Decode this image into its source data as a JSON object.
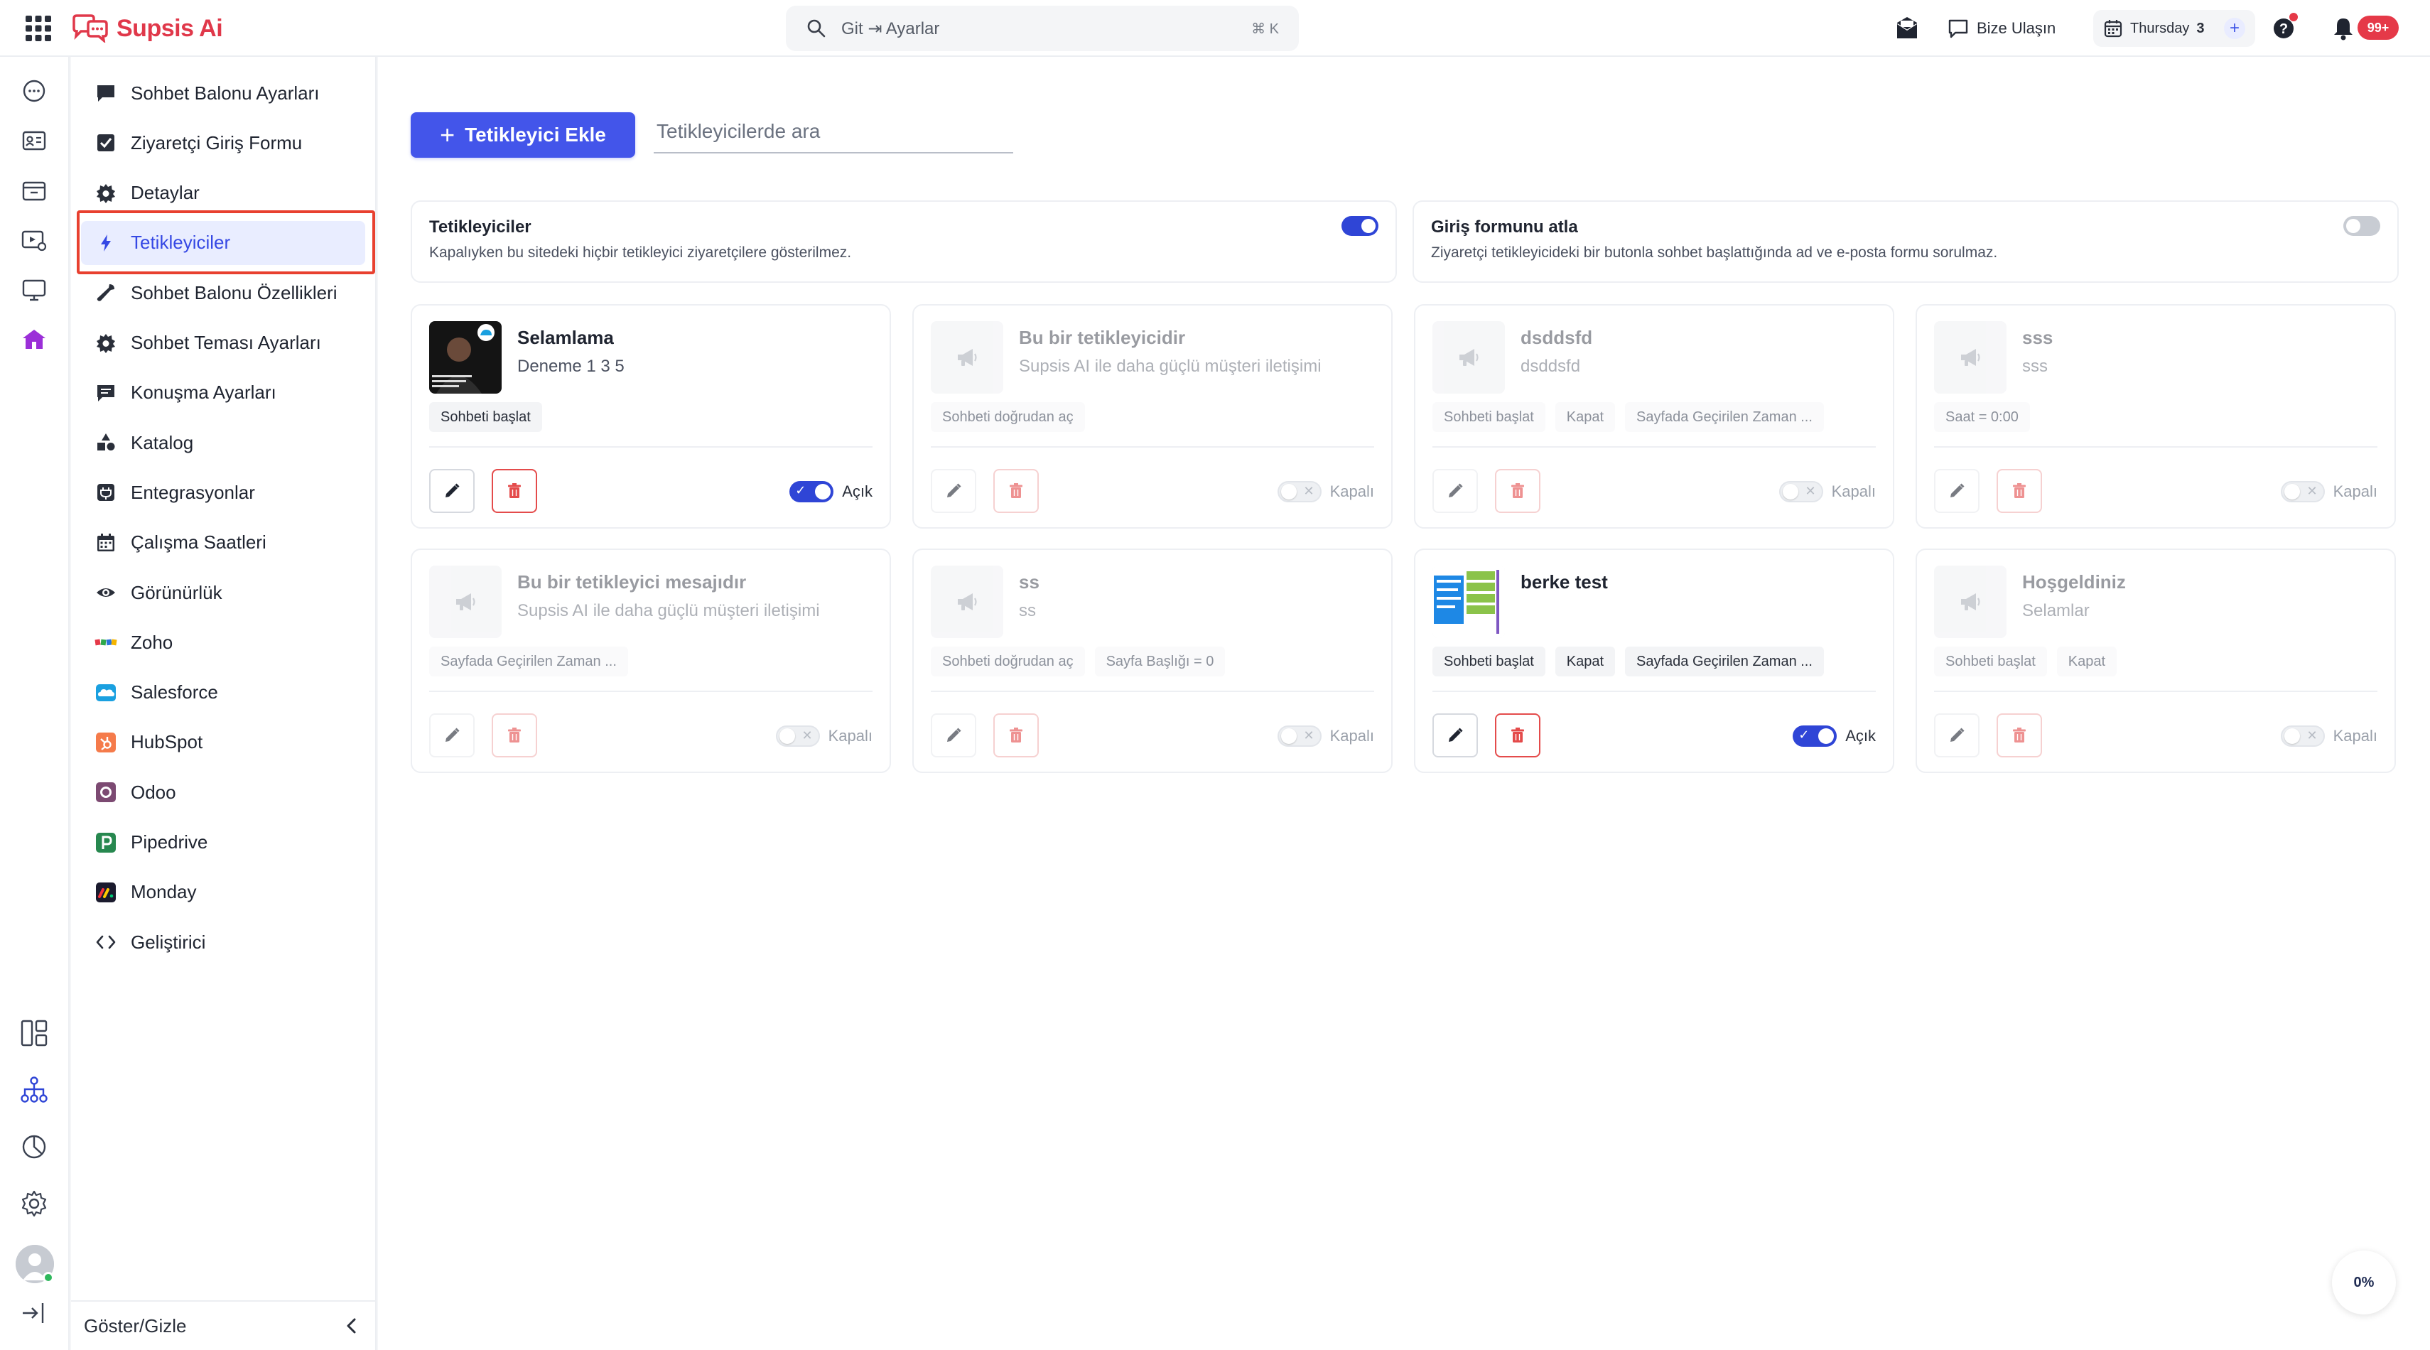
{
  "app": {
    "name": "Supsis Ai",
    "brand_color": "#e0384a",
    "accent_color": "#4355ea"
  },
  "topbar": {
    "search_text": "Git ⇥ Ayarlar",
    "search_shortcut": "⌘ K",
    "contact_label": "Bize Ulaşın",
    "date_day": "Thursday",
    "date_num": "3",
    "date_plus": "+",
    "notification_badge": "99+"
  },
  "sidebar": {
    "items": [
      {
        "label": "Sohbet Balonu Ayarları",
        "icon": "chat-bubble-icon"
      },
      {
        "label": "Ziyaretçi Giriş Formu",
        "icon": "checkbox-icon"
      },
      {
        "label": "Detaylar",
        "icon": "gear-icon"
      },
      {
        "label": "Tetikleyiciler",
        "icon": "lightning-icon",
        "active": true
      },
      {
        "label": "Sohbet Balonu Özellikleri",
        "icon": "wrench-icon"
      },
      {
        "label": "Sohbet Teması Ayarları",
        "icon": "gear-icon"
      },
      {
        "label": "Konuşma Ayarları",
        "icon": "message-icon"
      },
      {
        "label": "Katalog",
        "icon": "shapes-icon"
      },
      {
        "label": "Entegrasyonlar",
        "icon": "plug-icon"
      },
      {
        "label": "Çalışma Saatleri",
        "icon": "calendar-icon"
      },
      {
        "label": "Görünürlük",
        "icon": "eye-icon"
      },
      {
        "label": "Zoho",
        "icon": "zoho-icon"
      },
      {
        "label": "Salesforce",
        "icon": "salesforce-icon"
      },
      {
        "label": "HubSpot",
        "icon": "hubspot-icon"
      },
      {
        "label": "Odoo",
        "icon": "odoo-icon"
      },
      {
        "label": "Pipedrive",
        "icon": "pipedrive-icon"
      },
      {
        "label": "Monday",
        "icon": "monday-icon"
      },
      {
        "label": "Geliştirici",
        "icon": "code-icon"
      }
    ],
    "footer_label": "Göster/Gizle"
  },
  "main": {
    "add_button_label": "Tetikleyici Ekle",
    "search_placeholder": "Tetikleyicilerde ara",
    "toggles": [
      {
        "title": "Tetikleyiciler",
        "desc": "Kapalıyken bu sitedeki hiçbir tetikleyici ziyaretçilere gösterilmez.",
        "on": true
      },
      {
        "title": "Giriş formunu atla",
        "desc": "Ziyaretçi tetikleyicideki bir butonla sohbet başlattığında ad ve e-posta formu sorulmaz.",
        "on": false
      }
    ],
    "cards": [
      {
        "title": "Selamlama",
        "subtitle": "Deneme 1 3 5",
        "tags": [
          "Sohbeti başlat"
        ],
        "state": "Açık",
        "on": true,
        "thumb": "photo"
      },
      {
        "title": "Bu bir tetikleyicidir",
        "subtitle": "Supsis AI ile daha güçlü müşteri iletişimi",
        "tags": [
          "Sohbeti doğrudan aç"
        ],
        "state": "Kapalı",
        "on": false,
        "thumb": "megaphone"
      },
      {
        "title": "dsddsfd",
        "subtitle": "dsddsfd",
        "tags": [
          "Sohbeti başlat",
          "Kapat",
          "Sayfada Geçirilen Zaman ..."
        ],
        "state": "Kapalı",
        "on": false,
        "thumb": "megaphone"
      },
      {
        "title": "sss",
        "subtitle": "sss",
        "tags": [
          "Saat = 0:00"
        ],
        "state": "Kapalı",
        "on": false,
        "thumb": "megaphone"
      },
      {
        "title": "Bu bir tetikleyici mesajıdır",
        "subtitle": "Supsis AI ile daha güçlü müşteri iletişimi",
        "tags": [
          "Sayfada Geçirilen Zaman ..."
        ],
        "state": "Kapalı",
        "on": false,
        "thumb": "megaphone"
      },
      {
        "title": "ss",
        "subtitle": "ss",
        "tags": [
          "Sohbeti doğrudan aç",
          "Sayfa Başlığı = 0"
        ],
        "state": "Kapalı",
        "on": false,
        "thumb": "megaphone"
      },
      {
        "title": "berke test",
        "subtitle": "",
        "tags": [
          "Sohbeti başlat",
          "Kapat",
          "Sayfada Geçirilen Zaman ..."
        ],
        "state": "Açık",
        "on": true,
        "thumb": "screenshot"
      },
      {
        "title": "Hoşgeldiniz",
        "subtitle": "Selamlar",
        "tags": [
          "Sohbeti başlat",
          "Kapat"
        ],
        "state": "Kapalı",
        "on": false,
        "thumb": "megaphone"
      }
    ]
  },
  "progress_label": "0%"
}
